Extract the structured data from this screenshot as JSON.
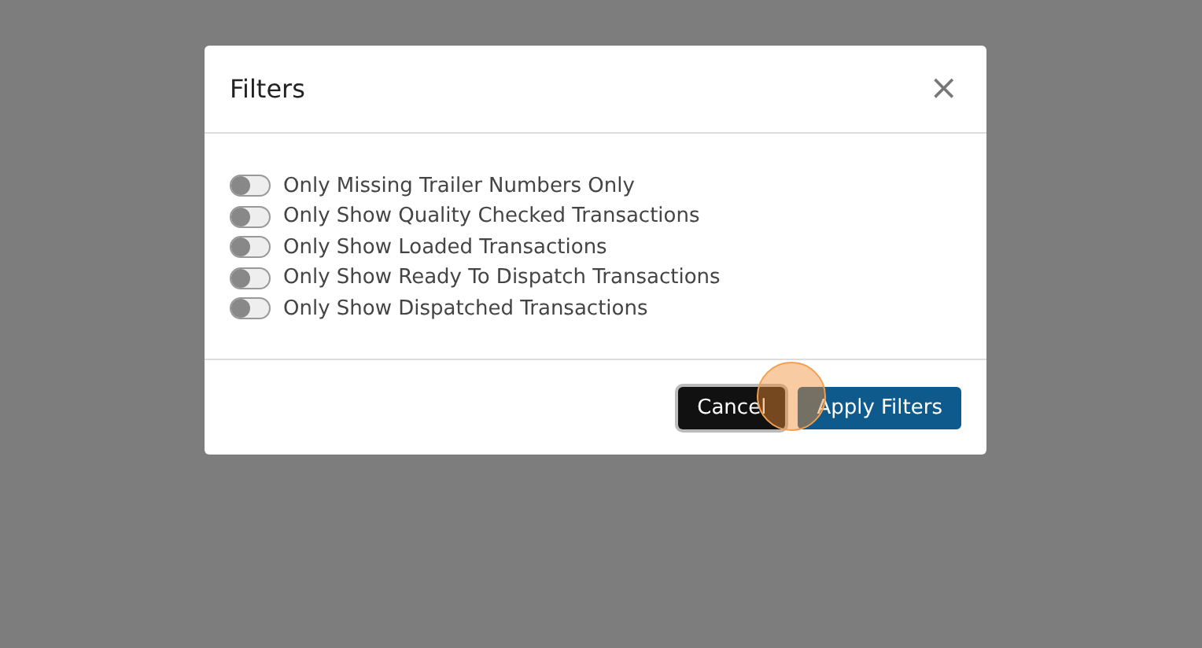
{
  "dialog": {
    "title": "Filters",
    "close": "×",
    "toggles": [
      {
        "label": "Only Missing Trailer Numbers Only",
        "on": false
      },
      {
        "label": "Only Show Quality Checked Transactions",
        "on": false
      },
      {
        "label": "Only Show Loaded Transactions",
        "on": false
      },
      {
        "label": "Only Show Ready To Dispatch Transactions",
        "on": false
      },
      {
        "label": "Only Show Dispatched Transactions",
        "on": false
      }
    ],
    "buttons": [
      {
        "label": "Cancel",
        "kind": "secondary"
      },
      {
        "label": "Apply Filters",
        "kind": "primary"
      }
    ]
  }
}
